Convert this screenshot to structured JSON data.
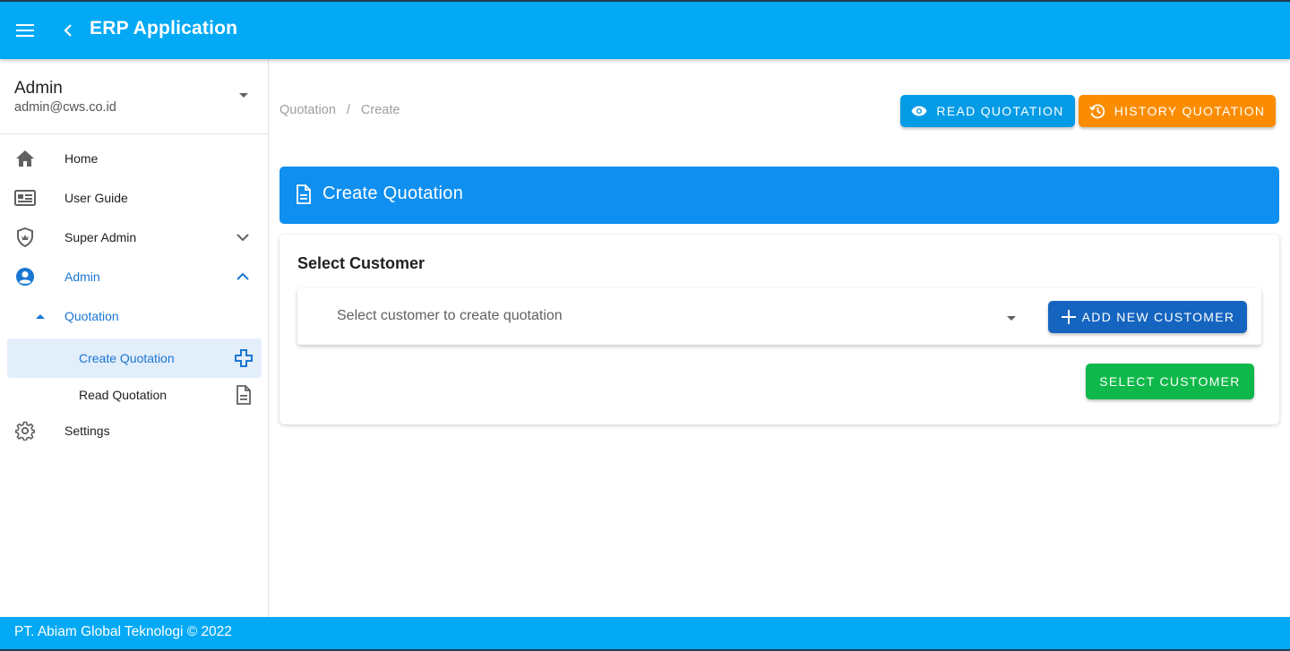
{
  "appbar": {
    "title": "ERP Application",
    "menu_icon": "hamburger-menu-icon",
    "back_icon": "chevron-left-icon",
    "background": "#03a9f4"
  },
  "user": {
    "name": "Admin",
    "email": "admin@cws.co.id"
  },
  "sidebar": {
    "items": [
      {
        "label": "Home",
        "icon": "home-icon"
      },
      {
        "label": "User Guide",
        "icon": "user-guide-icon"
      },
      {
        "label": "Super Admin",
        "icon": "shield-icon",
        "expanded": false
      },
      {
        "label": "Admin",
        "icon": "account-circle-icon",
        "expanded": true,
        "active": true
      },
      {
        "label": "Quotation",
        "icon": "caret-up-icon",
        "active": true
      },
      {
        "label": "Create Quotation",
        "icon": "plus-outline-icon",
        "selected": true
      },
      {
        "label": "Read Quotation",
        "icon": "document-icon"
      },
      {
        "label": "Settings",
        "icon": "gear-icon"
      }
    ]
  },
  "breadcrumb": {
    "items": [
      "Quotation",
      "/",
      "Create"
    ]
  },
  "actions": {
    "read_label": "Read Quotation",
    "history_label": "History Quotation",
    "read_color": "#039be5",
    "history_color": "#fb8c00"
  },
  "banner": {
    "title": "Create Quotation",
    "icon": "document-icon",
    "color": "#0f8ff0"
  },
  "card": {
    "title": "Select Customer",
    "select_placeholder": "Select customer to create quotation",
    "add_label": "Add New Customer",
    "select_label": "Select Customer",
    "add_color": "#1565c0",
    "select_color": "#0fb84a"
  },
  "footer": {
    "text": "PT. Abiam Global Teknologi © 2022"
  }
}
